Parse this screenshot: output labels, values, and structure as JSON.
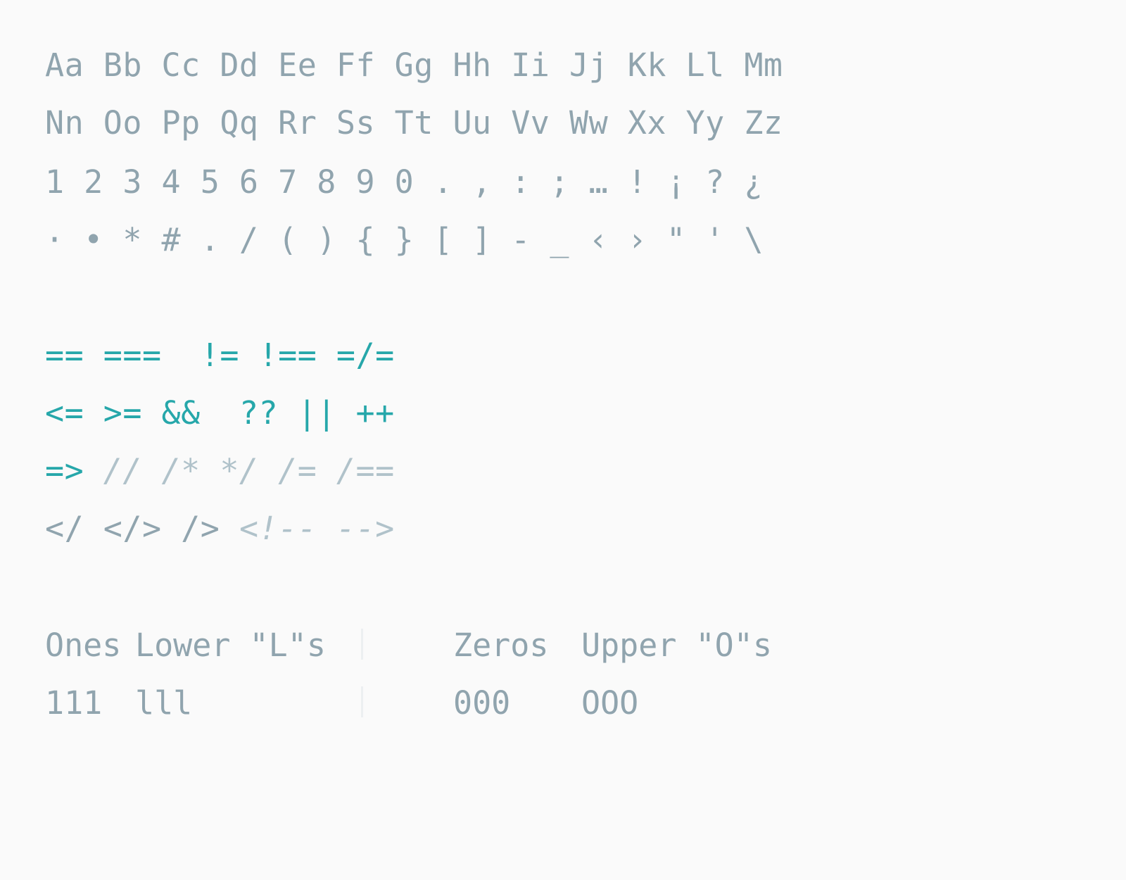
{
  "glyph_rows": [
    "Aa Bb Cc Dd Ee Ff Gg Hh Ii Jj Kk Ll Mm",
    "Nn Oo Pp Qq Rr Ss Tt Uu Vv Ww Xx Yy Zz",
    "1 2 3 4 5 6 7 8 9 0 . , : ; … ! ¡ ? ¿",
    "· • * # . / ( ) { } [ ] - _ ‹ › \" ' \\"
  ],
  "ligatures": {
    "row1": "== ===  != !== =/=",
    "row2": "<= >= &&  ?? || ++",
    "row3_op": "=> ",
    "row3_comment": "// /* */ /= /==",
    "row4_tags": "</ </> /> ",
    "row4_comment": "<!-- -->"
  },
  "comparison": {
    "ones_header": "Ones",
    "lower_l_header": "Lower \"L\"s",
    "zeros_header": "Zeros",
    "upper_o_header": "Upper \"O\"s",
    "ones_value": "111",
    "lower_l_value": "lll",
    "zeros_value": "000",
    "upper_o_value": "OOO"
  },
  "colors": {
    "background": "#fafafa",
    "text": "#90a4ae",
    "accent": "#26a7aa",
    "comment": "#b0c2ca"
  }
}
